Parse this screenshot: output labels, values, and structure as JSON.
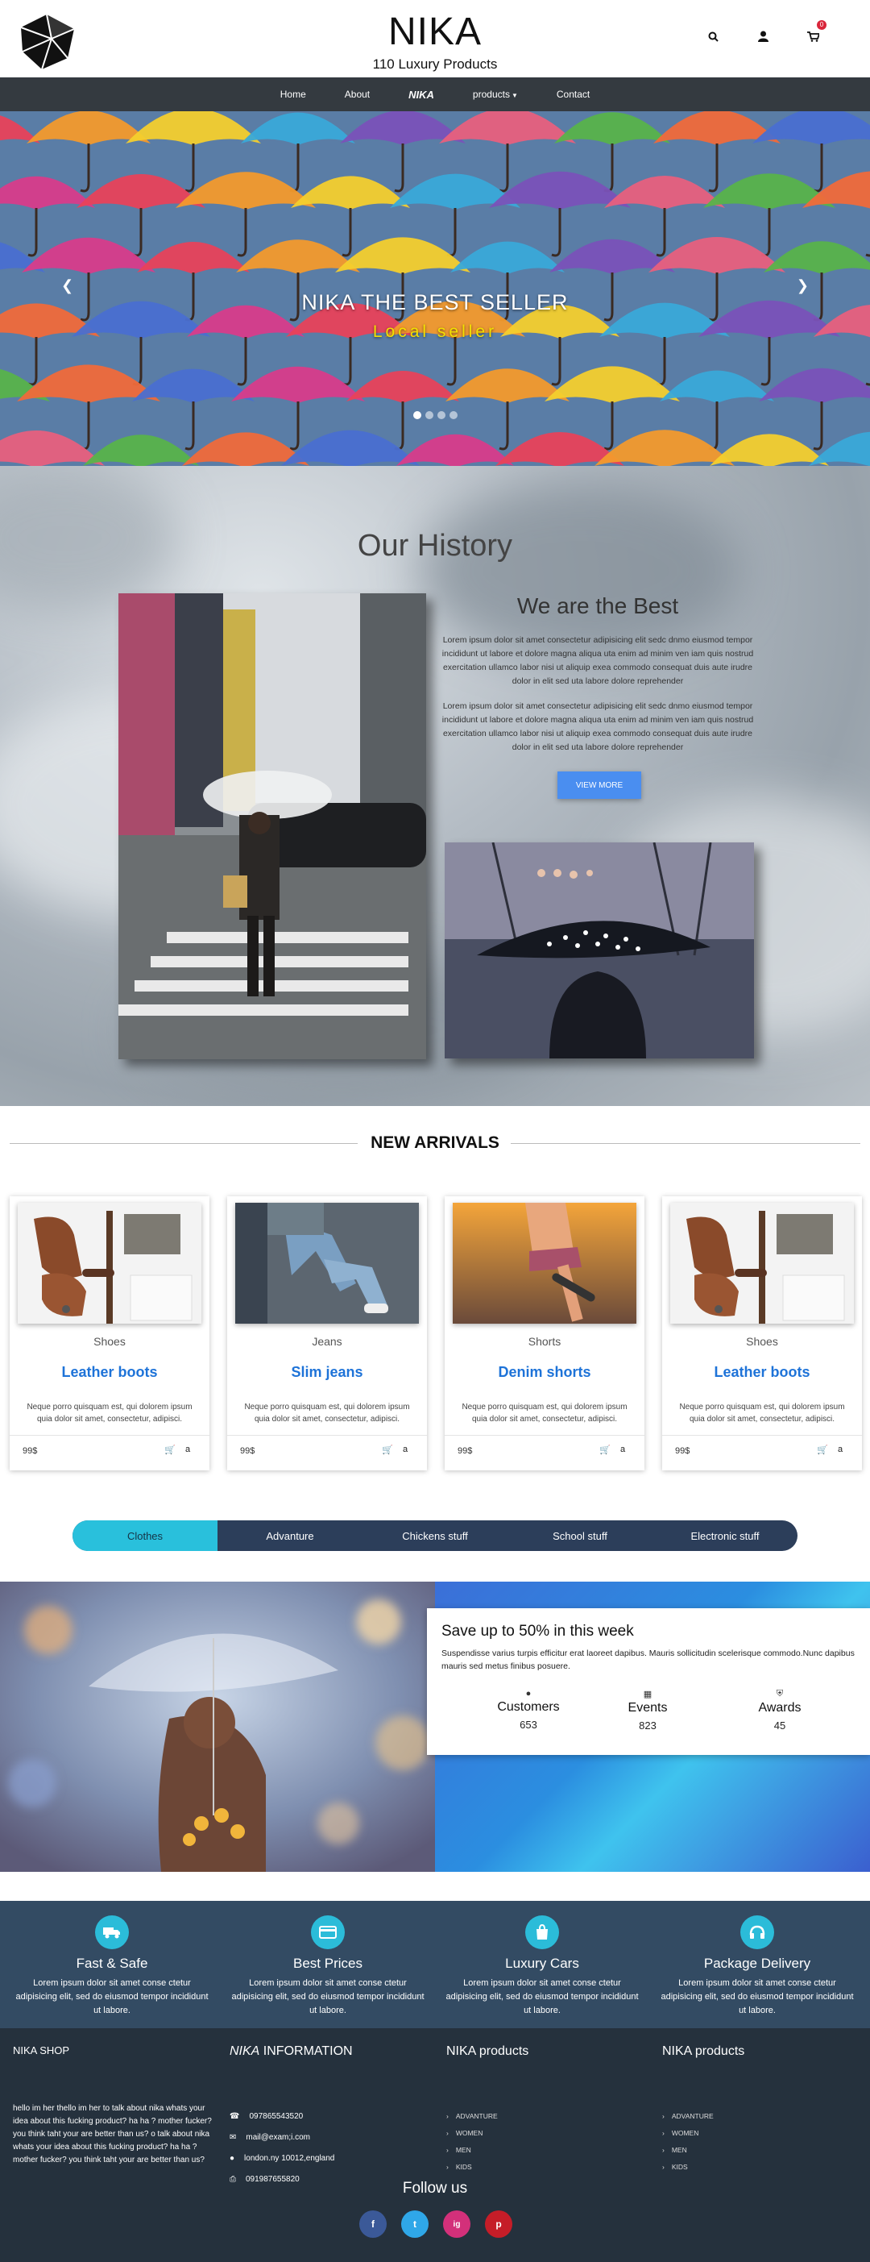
{
  "header": {
    "brand": "NIKA",
    "tagline": "110 Luxury Products",
    "cart_count": "0"
  },
  "nav": {
    "items": [
      "Home",
      "About",
      "NIKA",
      "products",
      "Contact"
    ]
  },
  "hero": {
    "title": "NIKA THE BEST SELLER",
    "subtitle": "Local seller"
  },
  "history": {
    "heading": "Our History",
    "subheading": "We are the Best",
    "para1": "Lorem ipsum dolor sit amet consectetur adipisicing elit sedc dnmo eiusmod tempor incididunt ut labore et dolore magna aliqua uta enim ad minim ven iam quis nostrud exercitation ullamco labor nisi ut aliquip exea commodo consequat duis aute irudre dolor in elit sed uta labore dolore reprehender",
    "para2": "Lorem ipsum dolor sit amet consectetur adipisicing elit sedc dnmo eiusmod tempor incididunt ut labore et dolore magna aliqua uta enim ad minim ven iam quis nostrud exercitation ullamco labor nisi ut aliquip exea commodo consequat duis aute irudre dolor in elit sed uta labore dolore reprehender",
    "button": "VIEW MORE"
  },
  "arrivals": {
    "title": "NEW ARRIVALS",
    "cards": [
      {
        "category": "Shoes",
        "name": "Leather boots",
        "desc": "Neque porro quisquam est, qui dolorem ipsum quia dolor sit amet, consectetur, adipisci.",
        "price": "99$"
      },
      {
        "category": "Jeans",
        "name": "Slim jeans",
        "desc": "Neque porro quisquam est, qui dolorem ipsum quia dolor sit amet, consectetur, adipisci.",
        "price": "99$"
      },
      {
        "category": "Shorts",
        "name": "Denim shorts",
        "desc": "Neque porro quisquam est, qui dolorem ipsum quia dolor sit amet, consectetur, adipisci.",
        "price": "99$"
      },
      {
        "category": "Shoes",
        "name": "Leather boots",
        "desc": "Neque porro quisquam est, qui dolorem ipsum quia dolor sit amet, consectetur, adipisci.",
        "price": "99$"
      }
    ]
  },
  "tabs": [
    "Clothes",
    "Advanture",
    "Chickens stuff",
    "School stuff",
    "Electronic stuff"
  ],
  "promo": {
    "title": "Save up to 50% in this week",
    "text": "Suspendisse varius turpis efficitur erat laoreet dapibus. Mauris sollicitudin scelerisque commodo.Nunc dapibus mauris sed metus finibus posuere.",
    "stats": [
      {
        "label": "Customers",
        "value": "653"
      },
      {
        "label": "Events",
        "value": "823"
      },
      {
        "label": "Awards",
        "value": "45"
      }
    ]
  },
  "features": [
    {
      "title": "Fast & Safe",
      "text": "Lorem ipsum dolor sit amet conse ctetur adipisicing elit, sed do eiusmod tempor incididunt ut labore."
    },
    {
      "title": "Best Prices",
      "text": "Lorem ipsum dolor sit amet conse ctetur adipisicing elit, sed do eiusmod tempor incididunt ut labore."
    },
    {
      "title": "Luxury Cars",
      "text": "Lorem ipsum dolor sit amet conse ctetur adipisicing elit, sed do eiusmod tempor incididunt ut labore."
    },
    {
      "title": "Package Delivery",
      "text": "Lorem ipsum dolor sit amet conse ctetur adipisicing elit, sed do eiusmod tempor incididunt ut labore."
    }
  ],
  "footer": {
    "shop_title": "NIKA SHOP",
    "shop_text": "hello im her thello im her to talk about nika whats your idea about this fucking product? ha ha ? mother fucker? you think taht your are better than us? o talk about nika whats your idea about this fucking product? ha ha ? mother fucker? you think taht your are better than us?",
    "info_title_brand": "NIKA",
    "info_title_rest": " INFORMATION",
    "phone": "097865543520",
    "email": "mail@exam;i.com",
    "address": "london.ny 10012,england",
    "fax": "091987655820",
    "products_title": "NIKA products",
    "products": [
      "ADVANTURE",
      "WOMEN",
      "MEN",
      "KIDS"
    ],
    "products2_title": "NIKA products",
    "products2": [
      "ADVANTURE",
      "WOMEN",
      "MEN",
      "KIDS"
    ],
    "follow": "Follow us",
    "social": [
      "f",
      "t",
      "ig",
      "p"
    ]
  }
}
